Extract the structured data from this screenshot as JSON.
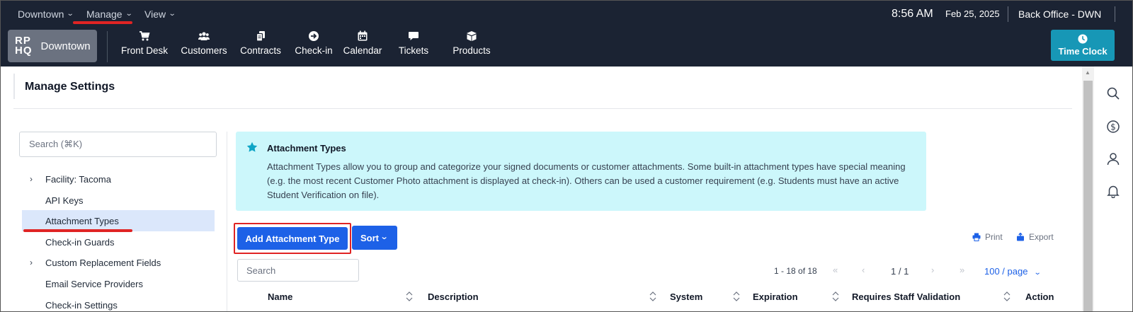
{
  "topbar": {
    "menus": [
      {
        "label": "Downtown"
      },
      {
        "label": "Manage"
      },
      {
        "label": "View"
      }
    ],
    "time": "8:56 AM",
    "date": "Feb 25, 2025",
    "location": "Back Office - DWN"
  },
  "brand": {
    "logo_line1": "RP",
    "logo_line2": "HQ",
    "name": "Downtown"
  },
  "nav": [
    {
      "label": "Front Desk",
      "icon": "cart-icon"
    },
    {
      "label": "Customers",
      "icon": "users-icon"
    },
    {
      "label": "Contracts",
      "icon": "documents-icon"
    },
    {
      "label": "Check-in",
      "icon": "arrow-circle-icon"
    },
    {
      "label": "Calendar",
      "icon": "calendar-icon"
    },
    {
      "label": "Tickets",
      "icon": "chat-icon"
    },
    {
      "label": "Products",
      "icon": "box-icon"
    }
  ],
  "time_clock": {
    "label": "Time Clock",
    "icon": "clock-icon"
  },
  "page": {
    "title": "Manage Settings"
  },
  "sidebar": {
    "search_placeholder": "Search (⌘K)",
    "items": [
      {
        "label": "Facility: Tacoma",
        "expandable": true
      },
      {
        "label": "API Keys",
        "expandable": false
      },
      {
        "label": "Attachment Types",
        "expandable": false,
        "active": true
      },
      {
        "label": "Check-in Guards",
        "expandable": false
      },
      {
        "label": "Custom Replacement Fields",
        "expandable": true
      },
      {
        "label": "Email Service Providers",
        "expandable": false
      },
      {
        "label": "Check-in Settings",
        "expandable": false
      }
    ]
  },
  "info": {
    "title": "Attachment Types",
    "body": "Attachment Types allow you to group and categorize your signed documents or customer attachments. Some built-in attachment types have special meaning (e.g. the most recent Customer Photo attachment is displayed at check-in). Others can be used a customer requirement (e.g. Students must have an active Student Verification on file)."
  },
  "toolbar": {
    "add_label": "Add Attachment Type",
    "sort_label": "Sort",
    "print_label": "Print",
    "export_label": "Export"
  },
  "table": {
    "search_placeholder": "Search",
    "range": "1 - 18 of 18",
    "page": "1 / 1",
    "per_page": "100 / page",
    "columns": [
      "Name",
      "Description",
      "System",
      "Expiration",
      "Requires Staff Validation",
      "Action"
    ]
  },
  "colors": {
    "nav_bg": "#1b2333",
    "primary": "#1d61e7",
    "info_bg": "#ccf7fb",
    "accent_teal": "#1797b6",
    "highlight_red": "#e02424"
  }
}
